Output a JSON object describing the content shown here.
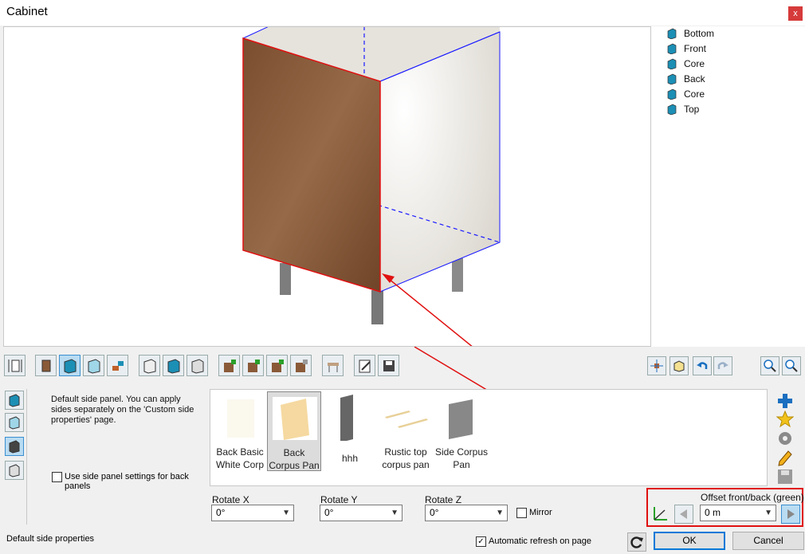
{
  "window": {
    "title": "Cabinet",
    "close_glyph": "x"
  },
  "tree": {
    "items": [
      {
        "label": "Bottom",
        "icon": "panel-icon"
      },
      {
        "label": "Front",
        "icon": "panel-icon"
      },
      {
        "label": "Core",
        "icon": "panel-icon"
      },
      {
        "label": "Back",
        "icon": "panel-icon"
      },
      {
        "label": "Core",
        "icon": "panel-icon"
      },
      {
        "label": "Top",
        "icon": "panel-icon"
      }
    ]
  },
  "description": "Default side panel. You can apply sides separately on the 'Custom side properties' page.",
  "back_panel_checkbox": {
    "label": "Use side panel settings for back panels",
    "checked": false
  },
  "gallery": {
    "items": [
      {
        "label": "Back Basic White Corp",
        "selected": false
      },
      {
        "label": "Back Corpus Pan",
        "selected": true
      },
      {
        "label": "hhh",
        "selected": false
      },
      {
        "label": "Rustic top corpus pan",
        "selected": false
      },
      {
        "label": "Side Corpus Pan",
        "selected": false
      }
    ]
  },
  "rotate": {
    "x": {
      "label": "Rotate X",
      "value": "0°"
    },
    "y": {
      "label": "Rotate Y",
      "value": "0°"
    },
    "z": {
      "label": "Rotate Z",
      "value": "0°"
    }
  },
  "mirror": {
    "label": "Mirror",
    "checked": false
  },
  "offset": {
    "label": "Offset front/back (green)",
    "value": "0 m"
  },
  "auto_refresh": {
    "label": "Automatic refresh on page",
    "checked": true,
    "check_glyph": "✓"
  },
  "buttons": {
    "ok": "OK",
    "cancel": "Cancel"
  },
  "status": "Default side properties",
  "colors": {
    "accent": "#0078d7",
    "highlight": "#e01010",
    "wood": "#8a5a38",
    "edge_blue": "#1a1aff"
  }
}
